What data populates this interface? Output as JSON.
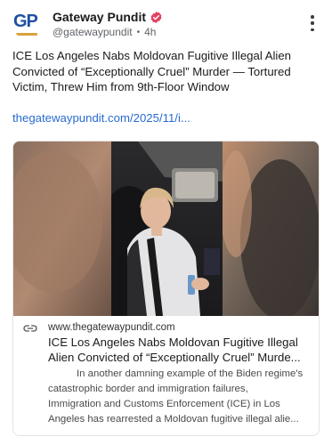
{
  "author": {
    "name": "Gateway Pundit",
    "handle": "@gatewaypundit",
    "time": "4h",
    "avatar_text": "GP",
    "verified": true,
    "brand_color": "#1f4fa3",
    "verified_color": "#e4405f"
  },
  "post": {
    "text": "ICE Los Angeles Nabs Moldovan Fugitive Illegal Alien Convicted of “Exceptionally Cruel” Murder — Tortured Victim, Threw Him from 9th-Floor Window",
    "link": "thegatewaypundit.com/2025/11/i..."
  },
  "card": {
    "domain": "www.thegatewaypundit.com",
    "title_line1": "ICE Los Angeles Nabs Moldovan Fugitive Illegal",
    "title_line2": "Alien Convicted of “Exceptionally Cruel” Murde...",
    "desc_line1": "In another damning example of the Biden regime's",
    "desc_line2": "catastrophic border and immigration failures,",
    "desc_line3": "Immigration and Customs Enforcement (ICE) in Los",
    "desc_line4": "Angeles has rearrested a Moldovan fugitive illegal alie...",
    "link_color": "#2a6bd1"
  },
  "icons": {
    "more": "more-vertical-icon",
    "verified": "verified-badge-icon",
    "link": "link-icon"
  }
}
